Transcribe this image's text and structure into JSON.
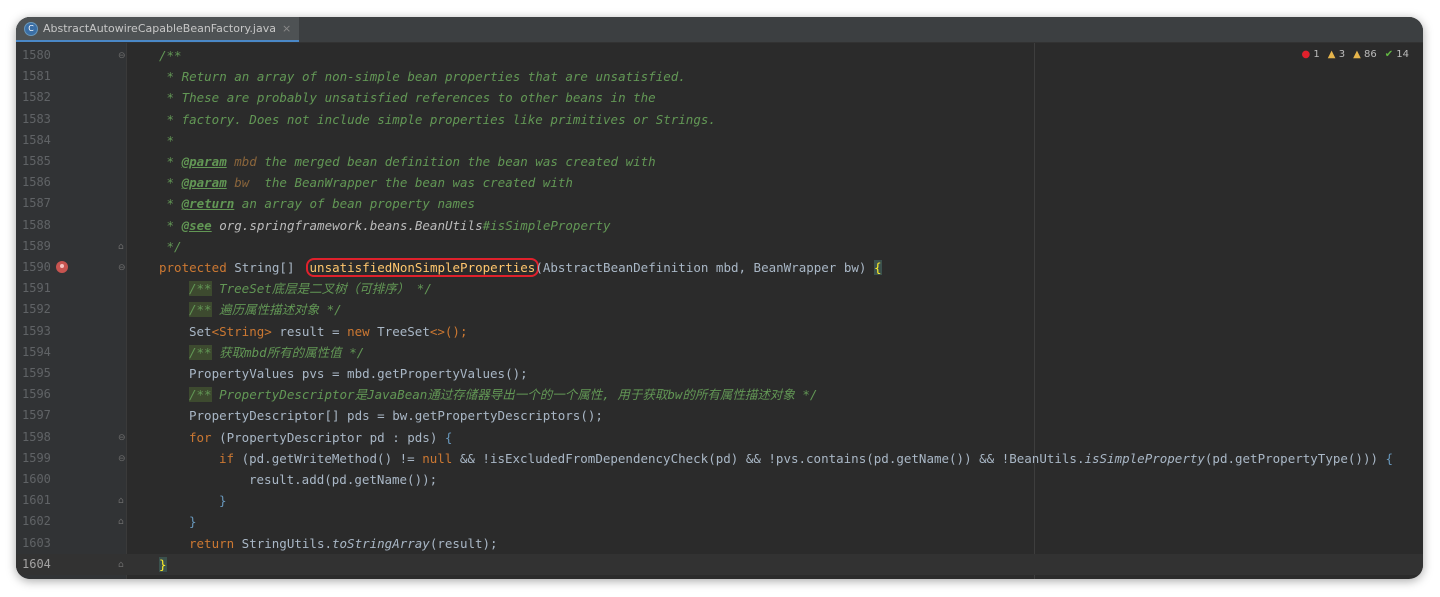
{
  "tab": {
    "icon": "java-class-icon",
    "label": "AbstractAutowireCapableBeanFactory.java",
    "close": "×"
  },
  "inspections": {
    "errors": "1",
    "warnings": "3",
    "weak_warnings": "86",
    "typos": "14",
    "error_icon": "error-icon",
    "warning_icon": "warning-icon",
    "ok_icon": "check-icon"
  },
  "lines": [
    {
      "num": "1580"
    },
    {
      "num": "1581"
    },
    {
      "num": "1582"
    },
    {
      "num": "1583"
    },
    {
      "num": "1584"
    },
    {
      "num": "1585"
    },
    {
      "num": "1586"
    },
    {
      "num": "1587"
    },
    {
      "num": "1588"
    },
    {
      "num": "1589"
    },
    {
      "num": "1590"
    },
    {
      "num": "1591"
    },
    {
      "num": "1592"
    },
    {
      "num": "1593"
    },
    {
      "num": "1594"
    },
    {
      "num": "1595"
    },
    {
      "num": "1596"
    },
    {
      "num": "1597"
    },
    {
      "num": "1598"
    },
    {
      "num": "1599"
    },
    {
      "num": "1600"
    },
    {
      "num": "1601"
    },
    {
      "num": "1602"
    },
    {
      "num": "1603"
    },
    {
      "num": "1604"
    }
  ],
  "code": {
    "l1580": "/**",
    "l1581": " * Return an array of non-simple bean properties that are unsatisfied.",
    "l1582": " * These are probably unsatisfied references to other beans in the",
    "l1583": " * factory. Does not include simple properties like primitives or Strings.",
    "l1584": " *",
    "l1585_a": " * ",
    "l1585_tag": "@param",
    "l1585_p": " mbd",
    "l1585_b": " the merged bean definition the bean was created with",
    "l1586_a": " * ",
    "l1586_tag": "@param",
    "l1586_p": " bw",
    "l1586_b": "  the BeanWrapper the bean was created with",
    "l1587_a": " * ",
    "l1587_tag": "@return",
    "l1587_b": " an array of bean property names",
    "l1588_a": " * ",
    "l1588_tag": "@see",
    "l1588_b": " org.springframework.beans.BeanUtils",
    "l1588_c": "#isSimpleProperty",
    "l1589": " */",
    "l1590_kw": "protected",
    "l1590_type": " String[]  ",
    "l1590_method": "unsatisfiedNonSimpleProperties",
    "l1590_args": "(AbstractBeanDefinition mbd, BeanWrapper bw) ",
    "l1590_brace": "{",
    "l1591_open": "/**",
    "l1591_text": " TreeSet底层是二叉树（可排序） */",
    "l1592_open": "/**",
    "l1592_text": " 遍历属性描述对象 */",
    "l1593_a": "Set",
    "l1593_b": "<String>",
    "l1593_c": " result = ",
    "l1593_kw": "new",
    "l1593_d": " TreeSet",
    "l1593_e": "<>();",
    "l1594_open": "/**",
    "l1594_text": " 获取mbd所有的属性值 */",
    "l1595": "PropertyValues pvs = mbd.getPropertyValues();",
    "l1596_open": "/**",
    "l1596_text": " PropertyDescriptor是JavaBean通过存储器导出一个的一个属性, 用于获取bw的所有属性描述对象 */",
    "l1597": "PropertyDescriptor[] pds = bw.getPropertyDescriptors();",
    "l1598_kw": "for",
    "l1598_b": " (PropertyDescriptor pd : pds) ",
    "l1598_brace": "{",
    "l1599_kw": "if",
    "l1599_a": " (pd.getWriteMethod() != ",
    "l1599_null": "null",
    "l1599_b": " && !isExcludedFromDependencyCheck(pd) && !pvs.contains(pd.getName()) && !BeanUtils.",
    "l1599_st": "isSimpleProperty",
    "l1599_c": "(pd.getPropertyType())) ",
    "l1599_brace": "{",
    "l1600": "result.add(pd.getName());",
    "l1601": "}",
    "l1602": "}",
    "l1603_kw": "return",
    "l1603_a": " StringUtils.",
    "l1603_st": "toStringArray",
    "l1603_b": "(result);",
    "l1604": "}"
  }
}
